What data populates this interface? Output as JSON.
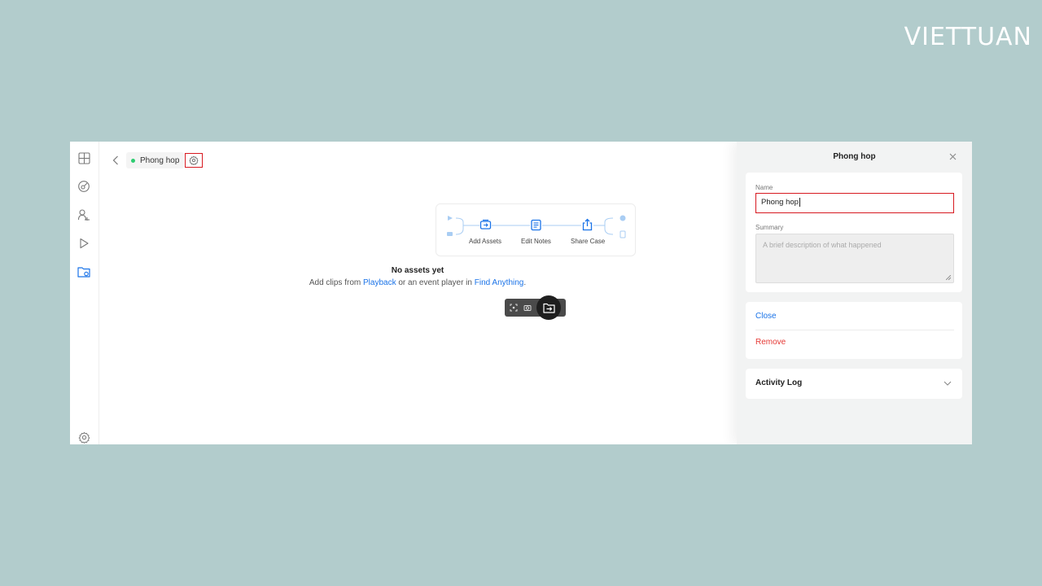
{
  "brand": {
    "logo_text": "VIETTUAN"
  },
  "rail": {
    "icons": [
      "grid-icon",
      "analytics-icon",
      "people-search-icon",
      "play-icon",
      "case-folder-icon",
      "settings-icon"
    ],
    "active_color": "#1a73e8"
  },
  "header": {
    "case_name": "Phong hop",
    "status_color": "#2ecc71"
  },
  "workflow": {
    "steps": [
      {
        "label": "Add Assets"
      },
      {
        "label": "Edit Notes"
      },
      {
        "label": "Share Case"
      }
    ]
  },
  "empty_state": {
    "title": "No assets yet",
    "desc_prefix": "Add clips from ",
    "link_playback": "Playback",
    "desc_middle": " or an event player in ",
    "link_find": "Find Anything",
    "desc_suffix": "."
  },
  "panel": {
    "title": "Phong hop",
    "name_label": "Name",
    "name_value": "Phong hop",
    "summary_label": "Summary",
    "summary_placeholder": "A brief description of what happened",
    "close_label": "Close",
    "remove_label": "Remove",
    "activity_log_label": "Activity Log"
  },
  "colors": {
    "background": "#b2cccc",
    "highlight": "#d71920",
    "link": "#1a73e8",
    "danger": "#e53935"
  }
}
